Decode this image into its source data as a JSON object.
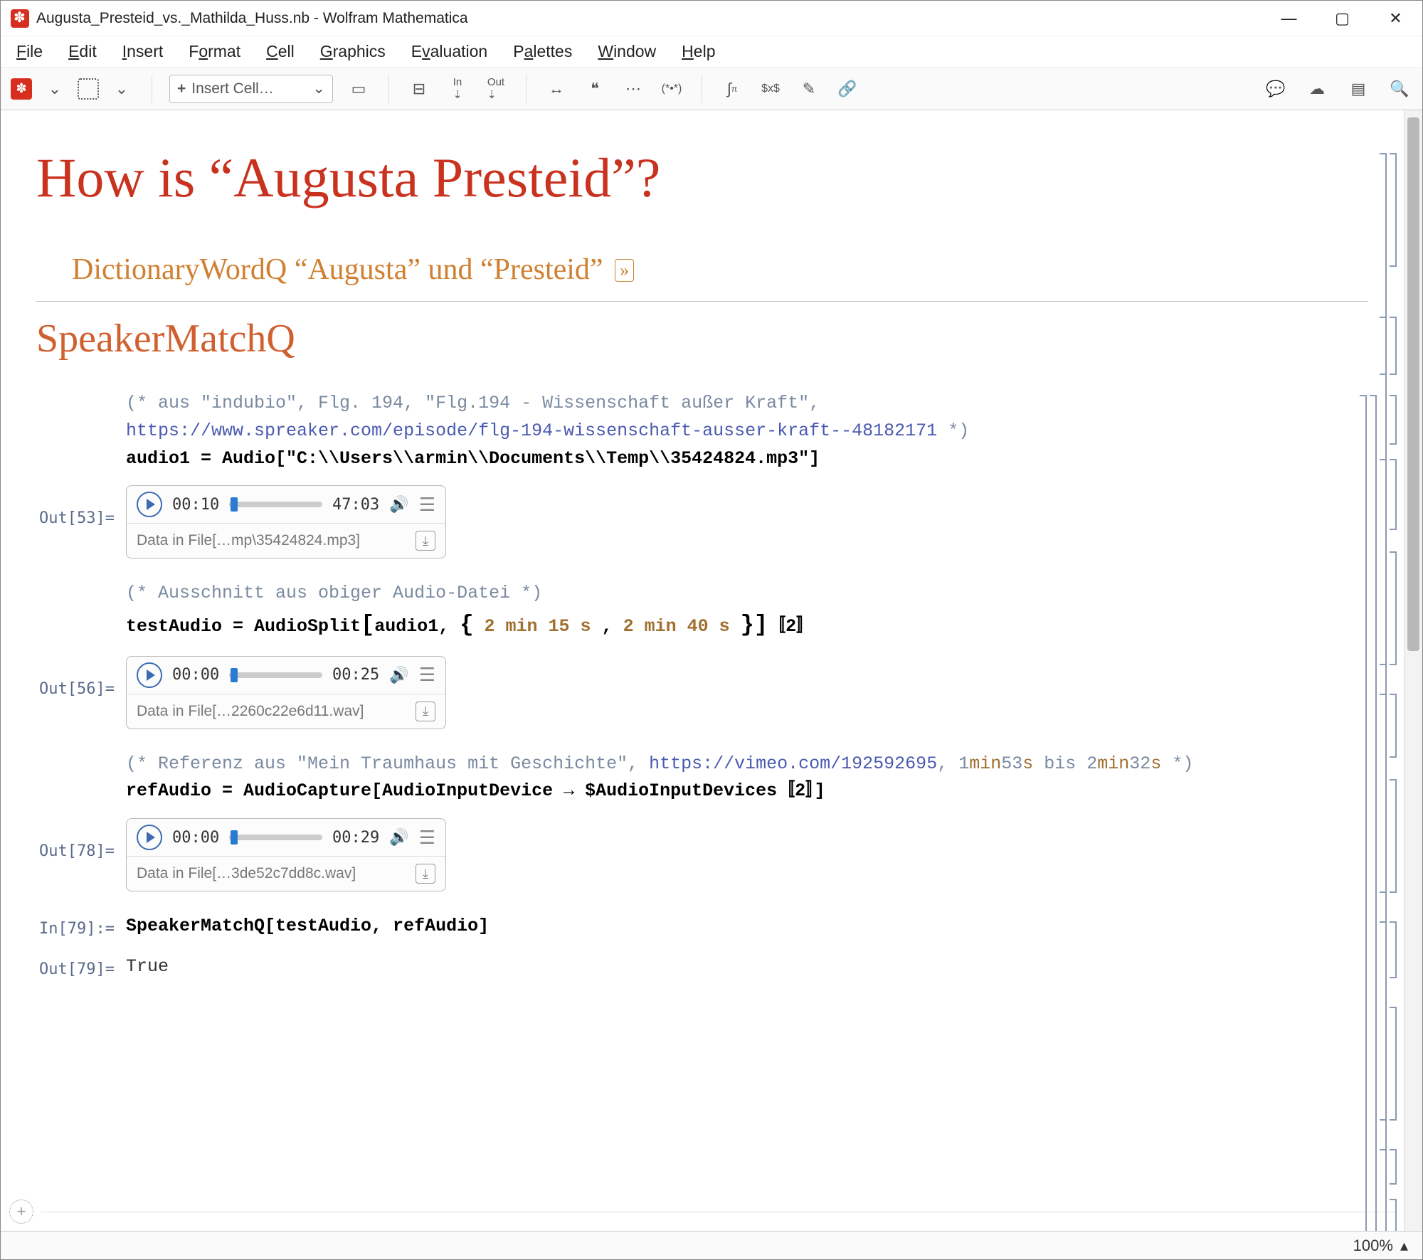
{
  "window": {
    "title": "Augusta_Presteid_vs._Mathilda_Huss.nb - Wolfram Mathematica"
  },
  "menu": {
    "file": "File",
    "edit": "Edit",
    "insert": "Insert",
    "format": "Format",
    "cell": "Cell",
    "graphics": "Graphics",
    "evaluation": "Evaluation",
    "palettes": "Palettes",
    "window": "Window",
    "help": "Help"
  },
  "toolbar": {
    "insert_cell": "Insert Cell…"
  },
  "doc": {
    "title": "How is “Augusta Presteid”?",
    "subsection": "DictionaryWordQ “Augusta” und “Presteid”",
    "section": "SpeakerMatchQ",
    "c1_comment1": "(* aus \"indubio\", Flg. 194, \"Flg.194 - Wissenschaft außer Kraft\",",
    "c1_link": "https://www.spreaker.com/episode/flg-194-wissenschaft-ausser-kraft--48182171",
    "c1_comment2": " *)",
    "c1_code": "audio1 = Audio[\"C:\\\\Users\\\\armin\\\\Documents\\\\Temp\\\\35424824.mp3\"]",
    "out53_label": "Out[53]=",
    "audio1": {
      "t1": "00:10",
      "t2": "47:03",
      "file": "Data in File[…mp\\35424824.mp3]"
    },
    "c2_comment": "(* Ausschnitt aus obiger Audio-Datei *)",
    "c2_a": "testAudio = AudioSplit",
    "c2_b": "audio1,",
    "c2_q1": "2 min 15 s",
    "c2_c": ",",
    "c2_q2": "2 min 40 s",
    "c2_d": "〚2〛",
    "out56_label": "Out[56]=",
    "audio2": {
      "t1": "00:00",
      "t2": "00:25",
      "file": "Data in File[…2260c22e6d11.wav]"
    },
    "c3_a": "(* Referenz aus \"Mein Traumhaus mit Geschichte\", ",
    "c3_link": "https://vimeo.com/192592695",
    "c3_b": ", 1",
    "c3_q1": "min",
    "c3_c": "53",
    "c3_q2": "s",
    "c3_d": " bis 2",
    "c3_q3": "min",
    "c3_e": "32",
    "c3_q4": "s",
    "c3_f": " *)",
    "c3_code": "refAudio = AudioCapture[AudioInputDevice → $AudioInputDevices〚2〛]",
    "out78_label": "Out[78]=",
    "audio3": {
      "t1": "00:00",
      "t2": "00:29",
      "file": "Data in File[…3de52c7dd8c.wav]"
    },
    "in79_label": "In[79]:=",
    "in79_code": "SpeakerMatchQ[testAudio, refAudio]",
    "out79_label": "Out[79]=",
    "out79_val": "True"
  },
  "status": {
    "zoom": "100%"
  }
}
